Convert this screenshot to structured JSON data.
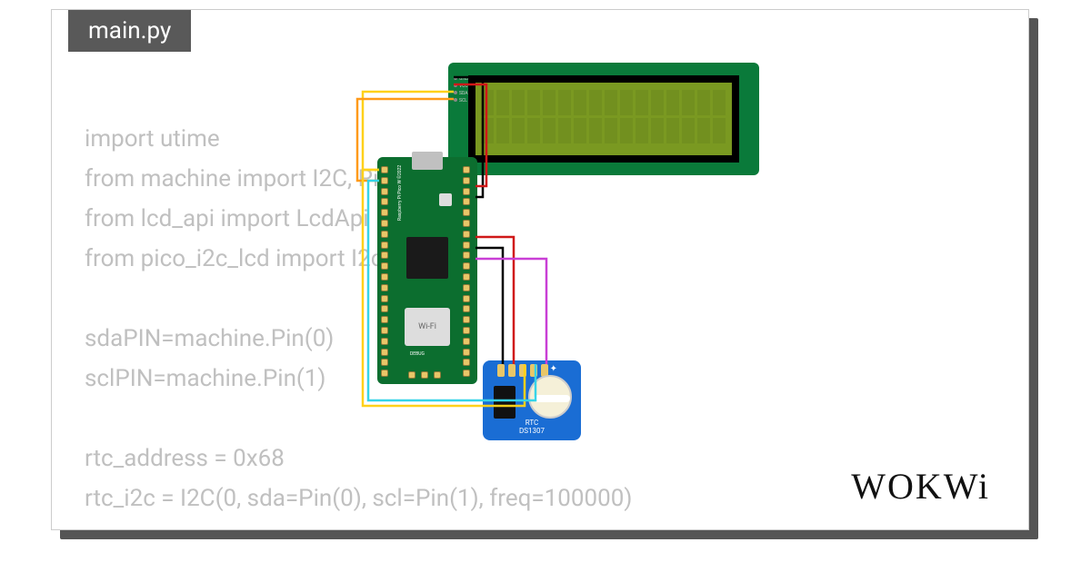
{
  "tab": {
    "filename": "main.py"
  },
  "code": {
    "line1": "import utime",
    "line2": "from machine import I2C, Pin",
    "line3": "from lcd_api import LcdApi",
    "line4": "from pico_i2c_lcd import I2cLcd",
    "line5": "",
    "line6": "sdaPIN=machine.Pin(0)",
    "line7": "sclPIN=machine.Pin(1)",
    "line8": "",
    "line9": "rtc_address = 0x68",
    "line10": "rtc_i2c = I2C(0, sda=Pin(0), scl=Pin(1), freq=100000)"
  },
  "components": {
    "lcd": {
      "type": "LCD 16x2 I2C",
      "pins": [
        "GND",
        "VCC",
        "SDA",
        "SCL"
      ]
    },
    "board": {
      "type": "Raspberry Pi Pico W",
      "wifi_label": "Wi-Fi",
      "debug_label": "DEBUG",
      "copyright": "Raspberry Pi Pico W ©2022"
    },
    "rtc": {
      "label_line1": "RTC",
      "label_line2": "DS1307",
      "pin_count": 5
    }
  },
  "wires": {
    "colors": {
      "gnd": "#000000",
      "vcc": "#d01818",
      "sda": "#ffd11a",
      "scl": "#ff9a1a",
      "scl2": "#36d4e8",
      "sda2": "#c93fd6"
    }
  },
  "brand": {
    "name": "WOKWi"
  }
}
